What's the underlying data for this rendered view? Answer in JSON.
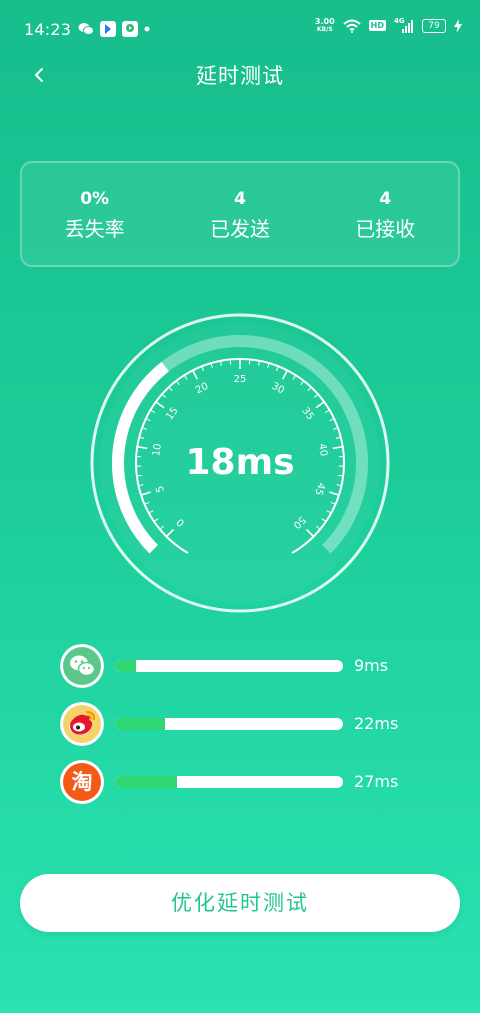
{
  "status_bar": {
    "time": "14:23",
    "net_speed_value": "3.00",
    "net_speed_unit": "KB/S",
    "hd_badge": "HD",
    "signal_label": "4G",
    "battery": "79"
  },
  "header": {
    "title": "延时测试"
  },
  "stats": [
    {
      "value": "0%",
      "label": "丢失率"
    },
    {
      "value": "4",
      "label": "已发送"
    },
    {
      "value": "4",
      "label": "已接收"
    }
  ],
  "gauge": {
    "value_text": "18ms",
    "value": 18,
    "min": 0,
    "max": 50,
    "ticks": [
      "0",
      "5",
      "10",
      "15",
      "20",
      "25",
      "30",
      "35",
      "40",
      "45",
      "50"
    ]
  },
  "apps": [
    {
      "name": "wechat",
      "latency_label": "9ms",
      "fill_percent": 9
    },
    {
      "name": "weibo",
      "latency_label": "22ms",
      "fill_percent": 22
    },
    {
      "name": "taobao",
      "icon_text": "淘",
      "latency_label": "27ms",
      "fill_percent": 27
    }
  ],
  "optimize_button": {
    "label": "优化延时测试"
  },
  "colors": {
    "background_top": "#18bd8c",
    "background_bottom": "#2ae3b1",
    "accent": "#22c58f",
    "bar_fill": "#2fd772",
    "wechat": "#5cc78a",
    "weibo": "#f6d36a",
    "taobao": "#f45a17"
  }
}
